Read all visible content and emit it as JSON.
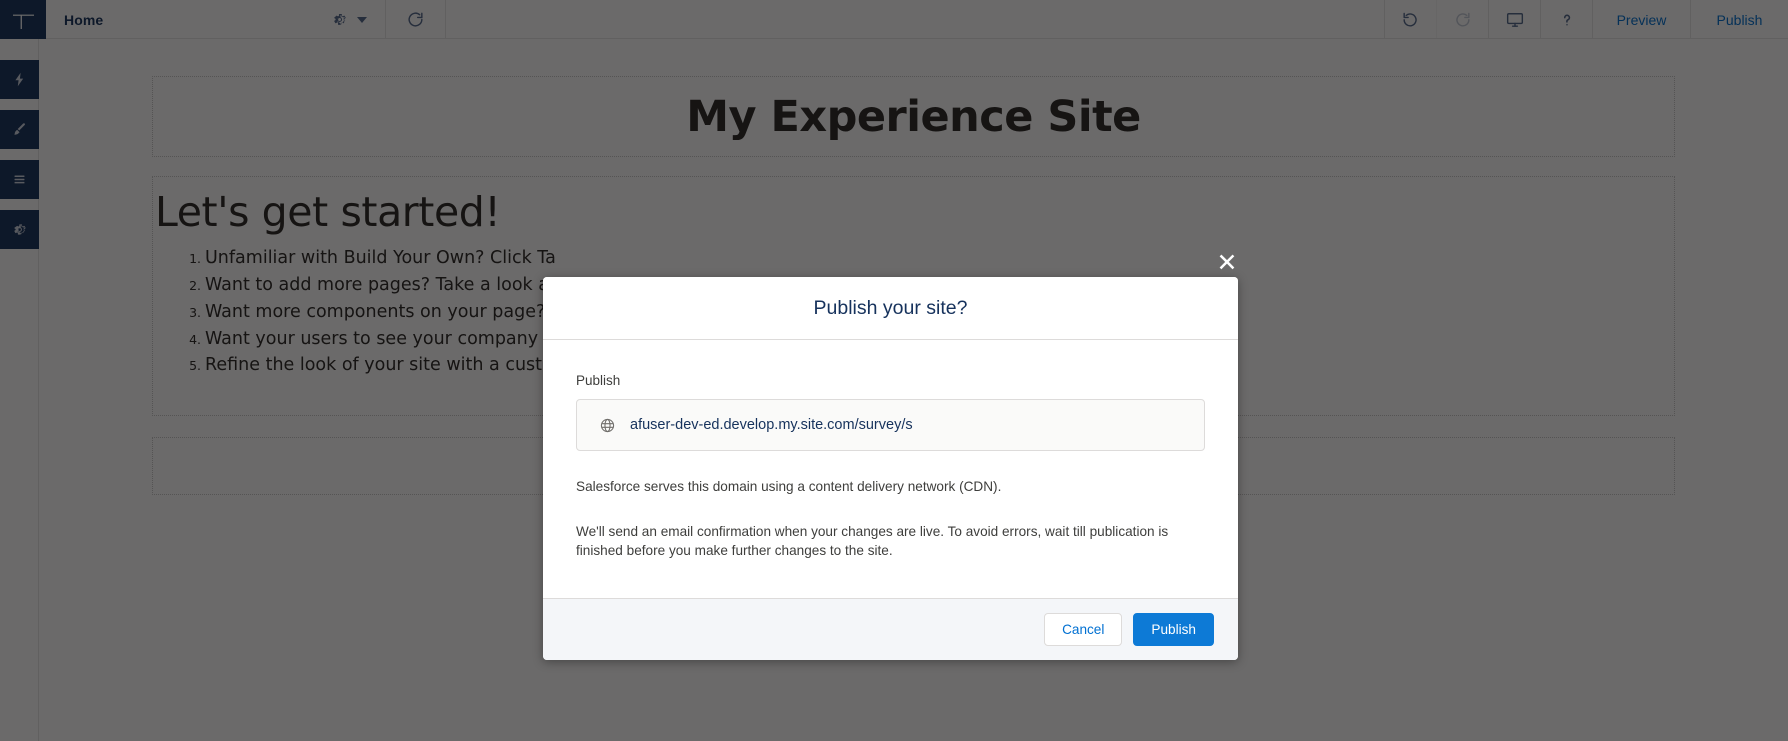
{
  "topbar": {
    "logo_icon": "experience-builder-logo-icon",
    "page_name": "Home",
    "page_settings_icon": "gear-icon",
    "page_settings_caret_icon": "chevron-down-icon",
    "refresh_icon": "refresh-icon",
    "undo_icon": "undo-icon",
    "redo_icon": "redo-icon",
    "device_icon": "desktop-preview-icon",
    "help_icon": "question-mark-icon",
    "preview_label": "Preview",
    "publish_label": "Publish"
  },
  "rail": {
    "items": [
      {
        "icon": "lightning-bolt-icon",
        "name": "components"
      },
      {
        "icon": "paintbrush-icon",
        "name": "theme"
      },
      {
        "icon": "hamburger-lines-icon",
        "name": "pages"
      },
      {
        "icon": "gear-icon",
        "name": "settings"
      }
    ]
  },
  "canvas": {
    "site_title": "My Experience Site",
    "heading": "Let's get started!",
    "list": [
      "Unfamiliar with Build Your Own? Click Ta",
      "Want to add more pages? Take a look at t",
      "Want more components on your page? D",
      "Want your users to see your company log",
      "Refine the look of your site with a custom"
    ]
  },
  "modal": {
    "title": "Publish your site?",
    "close_icon": "close-icon",
    "field_label": "Publish",
    "globe_icon": "globe-icon",
    "url": "afuser-dev-ed.develop.my.site.com/survey/s",
    "note_cdn": "Salesforce serves this domain using a content delivery network (CDN).",
    "note_email": "We'll send an email confirmation when your changes are live. To avoid errors, wait till publication is finished before you make further changes to the site.",
    "cancel_label": "Cancel",
    "publish_label": "Publish"
  },
  "colors": {
    "brand_blue": "#0d7ad6",
    "link_blue": "#0070d2",
    "navy": "#16325c",
    "overlay": "rgba(8,7,7,0.60)"
  }
}
